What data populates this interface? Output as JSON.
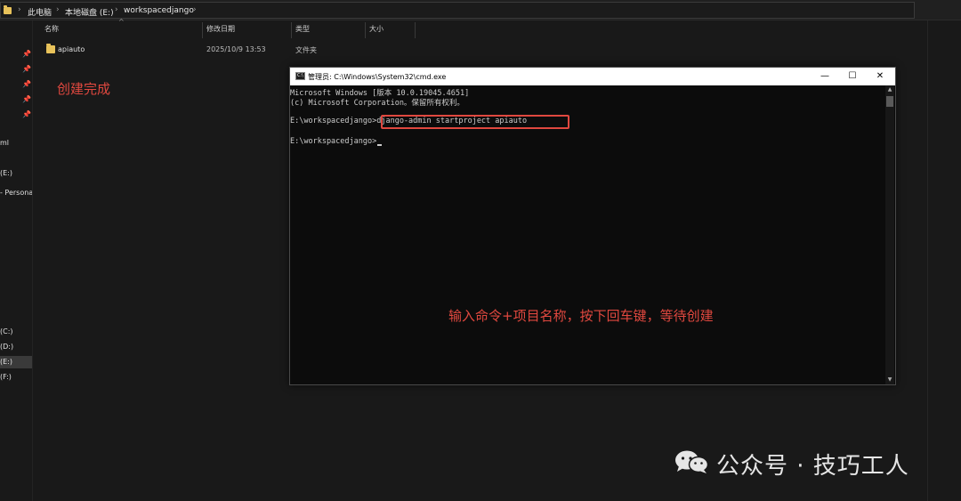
{
  "address_bar": {
    "crumbs": [
      "此电脑",
      "本地磁盘 (E:)",
      "workspacedjango"
    ],
    "separator": "›"
  },
  "sidebar": {
    "pins": [
      "📌",
      "📌",
      "📌",
      "📌",
      "📌"
    ],
    "items": [
      "ml",
      "(E:)",
      "- Persona",
      "(C:)",
      "(D:)",
      "(E:)",
      "(F:)"
    ],
    "selected_index": 5
  },
  "file_list": {
    "columns": [
      "名称",
      "修改日期",
      "类型",
      "大小"
    ],
    "sort_indicator": "^",
    "rows": [
      {
        "name": "apiauto",
        "modified": "2025/10/9 13:53",
        "type": "文件夹",
        "size": ""
      }
    ]
  },
  "annotations": {
    "created": "创建完成",
    "instruction": "输入命令+项目名称，按下回车键，等待创建"
  },
  "cmd_window": {
    "title": "管理员: C:\\Windows\\System32\\cmd.exe",
    "icon_label": "C:\\",
    "buttons": {
      "minimize": "—",
      "maximize": "☐",
      "close": "✕"
    },
    "lines": [
      "Microsoft Windows [版本 10.0.19045.4651]",
      "(c) Microsoft Corporation。保留所有权利。",
      "",
      "E:\\workspacedjango>django-admin startproject apiauto",
      "",
      "E:\\workspacedjango>"
    ],
    "scroll_up": "▲",
    "scroll_down": "▼"
  },
  "watermark": {
    "text": "公众号 · 技巧工人",
    "icon": "wechat-icon"
  }
}
